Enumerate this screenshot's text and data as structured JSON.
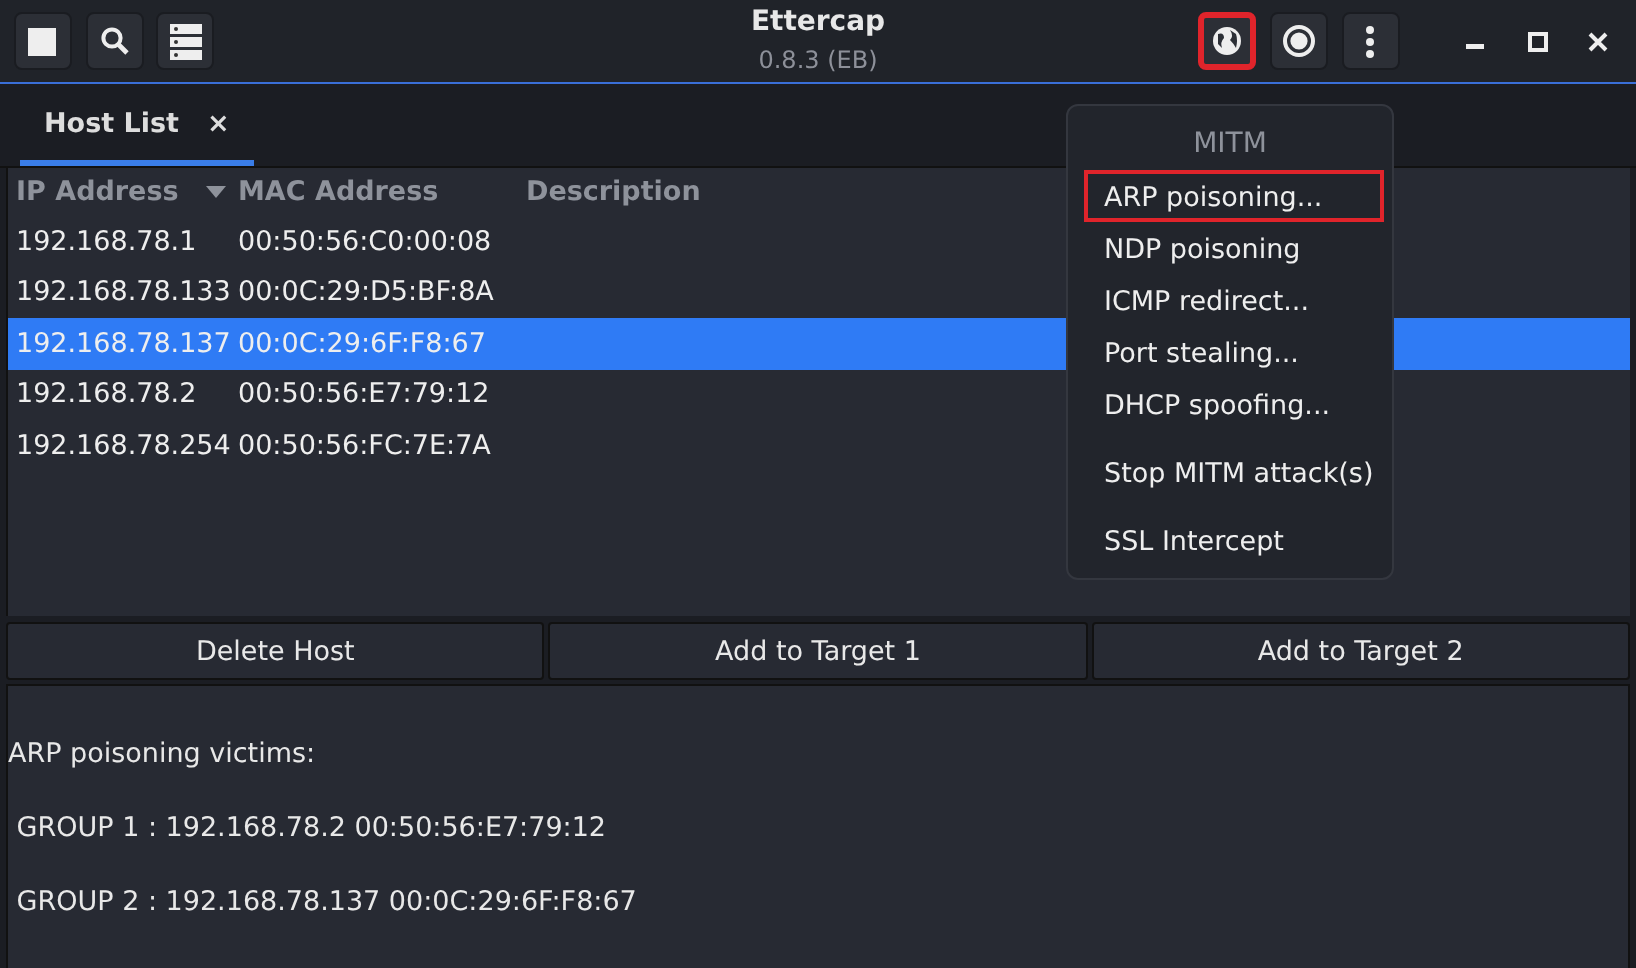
{
  "window": {
    "title": "Ettercap",
    "subtitle": "0.8.3 (EB)"
  },
  "toolbar_left": [
    {
      "kind": "stop"
    },
    {
      "kind": "search"
    },
    {
      "kind": "hosts"
    }
  ],
  "toolbar_right": [
    {
      "kind": "globe",
      "highlighted": true
    },
    {
      "kind": "record",
      "highlighted": false
    },
    {
      "kind": "more",
      "highlighted": false
    }
  ],
  "window_controls": [
    {
      "kind": "minimize"
    },
    {
      "kind": "maximize"
    },
    {
      "kind": "close"
    }
  ],
  "tabs": [
    {
      "label": "Host List",
      "close": "×",
      "selected": true
    }
  ],
  "table": {
    "columns": [
      {
        "label": "IP Address",
        "sorted": true
      },
      {
        "label": "MAC Address",
        "sorted": false
      },
      {
        "label": "Description",
        "sorted": false
      }
    ],
    "rows": [
      {
        "cells": [
          "192.168.78.1",
          "00:50:56:C0:00:08"
        ],
        "selected": false
      },
      {
        "cells": [
          "192.168.78.133",
          "00:0C:29:D5:BF:8A"
        ],
        "selected": false
      },
      {
        "cells": [
          "192.168.78.137",
          "00:0C:29:6F:F8:67"
        ],
        "selected": true
      },
      {
        "cells": [
          "192.168.78.2",
          "00:50:56:E7:79:12"
        ],
        "selected": false
      },
      {
        "cells": [
          "192.168.78.254",
          "00:50:56:FC:7E:7A"
        ],
        "selected": false
      }
    ]
  },
  "buttons": [
    "Delete Host",
    "Add to Target 1",
    "Add to Target 2"
  ],
  "log": [
    "ARP poisoning victims:",
    " GROUP 1 : 192.168.78.2 00:50:56:E7:79:12",
    " GROUP 2 : 192.168.78.137 00:0C:29:6F:F8:67"
  ],
  "menu": {
    "title": "MITM",
    "sections": [
      {
        "items": [
          {
            "label": "ARP poisoning...",
            "highlighted": true
          },
          {
            "label": "NDP poisoning",
            "highlighted": false
          },
          {
            "label": "ICMP redirect...",
            "highlighted": false
          },
          {
            "label": "Port stealing...",
            "highlighted": false
          },
          {
            "label": "DHCP spoofing...",
            "highlighted": false
          }
        ]
      },
      {
        "items": [
          {
            "label": "Stop MITM attack(s)",
            "highlighted": false
          }
        ]
      },
      {
        "items": [
          {
            "label": "SSL Intercept",
            "highlighted": false
          }
        ]
      }
    ]
  }
}
